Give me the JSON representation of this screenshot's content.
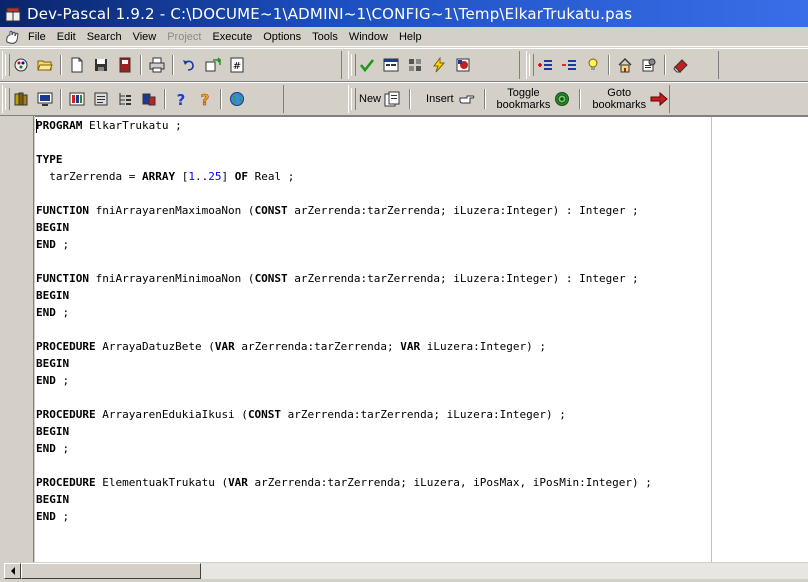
{
  "window": {
    "title": "Dev-Pascal 1.9.2 - C:\\DOCUME~1\\ADMINI~1\\CONFIG~1\\Temp\\ElkarTrukatu.pas"
  },
  "menu": {
    "items": [
      {
        "label": "File"
      },
      {
        "label": "Edit"
      },
      {
        "label": "Search"
      },
      {
        "label": "View"
      },
      {
        "label": "Project",
        "disabled": true
      },
      {
        "label": "Execute"
      },
      {
        "label": "Options"
      },
      {
        "label": "Tools"
      },
      {
        "label": "Window"
      },
      {
        "label": "Help"
      }
    ]
  },
  "toolbar2": {
    "new_label": "New",
    "insert_label": "Insert",
    "toggle_bookmarks_line1": "Toggle",
    "toggle_bookmarks_line2": "bookmarks",
    "goto_bookmarks_line1": "Goto",
    "goto_bookmarks_line2": "bookmarks"
  },
  "icons": {
    "app": "dev-pascal-book-icon",
    "menu": "pascal-hand-icon"
  },
  "colors": {
    "title_start": "#0a246a",
    "title_end": "#3a6ee8",
    "keyword": "#000000",
    "number": "#0000ff"
  },
  "code": {
    "lines": [
      {
        "t": "PROGRAM ElkarTrukatu ;"
      },
      {
        "t": ""
      },
      {
        "t": "TYPE"
      },
      {
        "t": "  tarZerrenda = ARRAY [1..25] OF Real ;"
      },
      {
        "t": ""
      },
      {
        "t": "FUNCTION fniArrayarenMaximoaNon (CONST arZerrenda:tarZerrenda; iLuzera:Integer) : Integer ;"
      },
      {
        "t": "BEGIN"
      },
      {
        "t": "END ;"
      },
      {
        "t": ""
      },
      {
        "t": "FUNCTION fniArrayarenMinimoaNon (CONST arZerrenda:tarZerrenda; iLuzera:Integer) : Integer ;"
      },
      {
        "t": "BEGIN"
      },
      {
        "t": "END ;"
      },
      {
        "t": ""
      },
      {
        "t": "PROCEDURE ArrayaDatuzBete (VAR arZerrenda:tarZerrenda; VAR iLuzera:Integer) ;"
      },
      {
        "t": "BEGIN"
      },
      {
        "t": "END ;"
      },
      {
        "t": ""
      },
      {
        "t": "PROCEDURE ArrayarenEdukiaIkusi (CONST arZerrenda:tarZerrenda; iLuzera:Integer) ;"
      },
      {
        "t": "BEGIN"
      },
      {
        "t": "END ;"
      },
      {
        "t": ""
      },
      {
        "t": "PROCEDURE ElementuakTrukatu (VAR arZerrenda:tarZerrenda; iLuzera, iPosMax, iPosMin:Integer) ;"
      },
      {
        "t": "BEGIN"
      },
      {
        "t": "END ;"
      }
    ]
  }
}
